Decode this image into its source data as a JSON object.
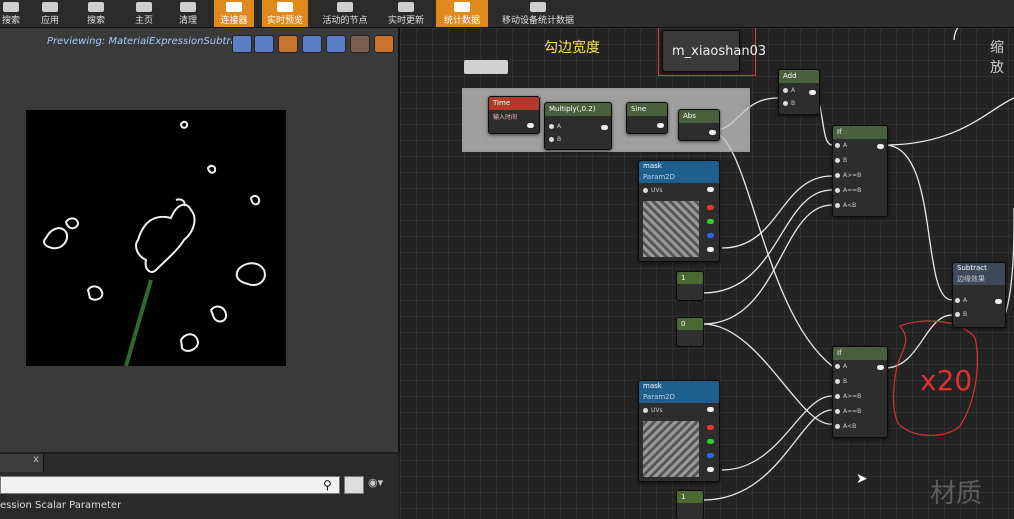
{
  "toolbar": {
    "items": [
      {
        "label": "搜索"
      },
      {
        "label": "应用"
      },
      {
        "label": "搜索"
      },
      {
        "label": "主页"
      },
      {
        "label": "清理"
      },
      {
        "label": "连接器"
      },
      {
        "label": "实时预览"
      },
      {
        "label": "活动的节点"
      },
      {
        "label": "实时更新"
      },
      {
        "label": "统计数据"
      },
      {
        "label": "移动设备统计数据"
      }
    ]
  },
  "preview": {
    "title": "Previewing: MaterialExpressionSubtrat"
  },
  "bottom_panel": {
    "tab_close": "x",
    "label": "ession Scalar Parameter"
  },
  "graph": {
    "outline_label": "勾边宽度",
    "selected_param_name": "m_xiaoshan03",
    "scale_label": "缩放",
    "watermark": "材质",
    "annotation_x20": "x20",
    "comment_label": "",
    "nodes": {
      "time": {
        "title": "Time",
        "subtitle": "输入时间"
      },
      "multiply": {
        "title": "Multiply(,0.2)",
        "pin_a": "A",
        "pin_b": "B"
      },
      "sine": {
        "title": "Sine"
      },
      "abs": {
        "title": "Abs"
      },
      "add": {
        "title": "Add",
        "pin_a": "A",
        "pin_b": "B"
      },
      "if1": {
        "title": "If",
        "pins": [
          "A",
          "B",
          "A>=B",
          "A==B",
          "A<B"
        ]
      },
      "mask1": {
        "title": "mask",
        "subtitle": "Param2D",
        "uvs": "UVs"
      },
      "mask2": {
        "title": "mask",
        "subtitle": "Param2D",
        "uvs": "UVs"
      },
      "const1": {
        "value": "1"
      },
      "const0": {
        "value": "0"
      },
      "const1b": {
        "value": "1"
      },
      "subtract": {
        "title": "Subtract",
        "subtitle": "边缘效果",
        "pin_a": "A",
        "pin_b": "B"
      },
      "if2": {
        "title": "If",
        "pins": [
          "A",
          "B",
          "A>=B",
          "A==B",
          "A<B"
        ]
      }
    }
  },
  "colors": {
    "accent_orange": "#e08a1e",
    "preview_title": "#a9c7ff",
    "annotation_red": "#e03030",
    "outline_label_yellow": "#ffe24a"
  }
}
